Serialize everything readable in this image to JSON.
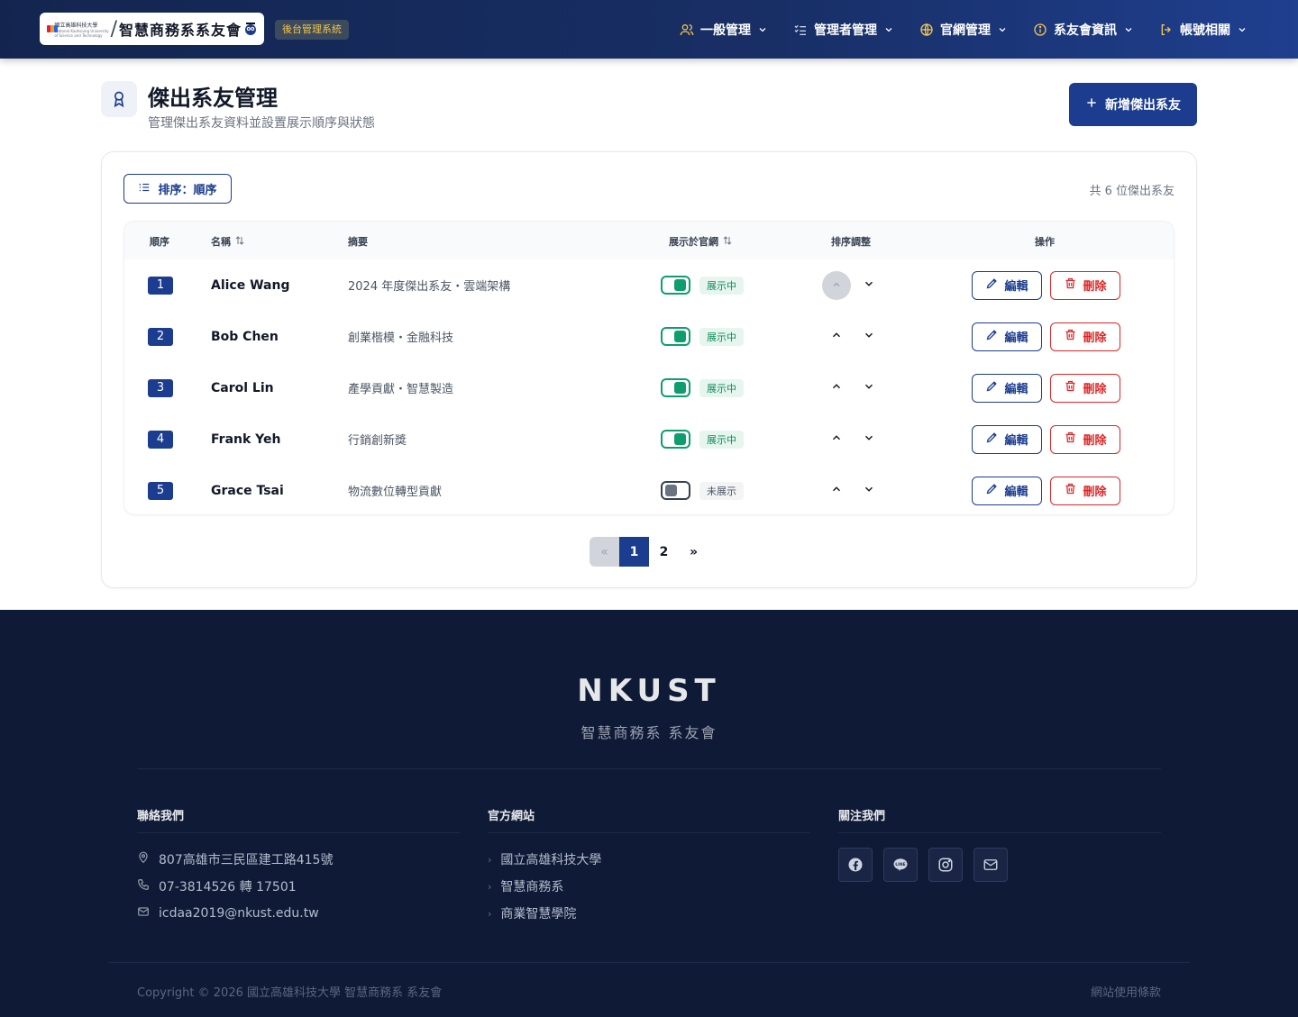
{
  "header": {
    "logo_school": "國立高雄科技大學",
    "logo_school_en1": "National Kaohsiung University",
    "logo_school_en2": "of Science and Technology",
    "logo_name": "智慧商務系系友會",
    "system_badge": "後台管理系統",
    "nav": [
      {
        "label": "一般管理",
        "icon": "users-icon"
      },
      {
        "label": "管理者管理",
        "icon": "checklist-icon"
      },
      {
        "label": "官網管理",
        "icon": "globe-icon"
      },
      {
        "label": "系友會資訊",
        "icon": "info-icon"
      },
      {
        "label": "帳號相關",
        "icon": "logout-icon"
      }
    ]
  },
  "page": {
    "title": "傑出系友管理",
    "subtitle": "管理傑出系友資料並設置展示順序與狀態",
    "add_button": "新增傑出系友",
    "sort_button": "排序：順序",
    "count_text": "共 6 位傑出系友"
  },
  "table": {
    "headers": [
      "順序",
      "名稱",
      "摘要",
      "展示於官網",
      "排序調整",
      "操作"
    ],
    "edit_label": "編輯",
    "delete_label": "刪除",
    "rows": [
      {
        "order": "1",
        "name": "Alice Wang",
        "summary": "2024 年度傑出系友・雲端架構",
        "status": "展示中",
        "visible": true
      },
      {
        "order": "2",
        "name": "Bob Chen",
        "summary": "創業楷模・金融科技",
        "status": "展示中",
        "visible": true
      },
      {
        "order": "3",
        "name": "Carol Lin",
        "summary": "產學貢獻・智慧製造",
        "status": "展示中",
        "visible": true
      },
      {
        "order": "4",
        "name": "Frank Yeh",
        "summary": "行銷創新獎",
        "status": "展示中",
        "visible": true
      },
      {
        "order": "5",
        "name": "Grace Tsai",
        "summary": "物流數位轉型貢獻",
        "status": "未展示",
        "visible": false
      }
    ]
  },
  "pagination": {
    "prev": "«",
    "pages": [
      "1",
      "2"
    ],
    "current": "1",
    "next": "»"
  },
  "footer": {
    "brand": "NKUST",
    "brand_sub": "智慧商務系 系友會",
    "contact_title": "聯絡我們",
    "contact": [
      {
        "icon": "map-pin-icon",
        "text": "807高雄市三民區建工路415號"
      },
      {
        "icon": "phone-icon",
        "text": "07-3814526 轉 17501"
      },
      {
        "icon": "mail-icon",
        "text": "icdaa2019@nkust.edu.tw"
      }
    ],
    "sites_title": "官方網站",
    "sites": [
      "國立高雄科技大學",
      "智慧商務系",
      "商業智慧學院"
    ],
    "follow_title": "關注我們",
    "socials": [
      "facebook-icon",
      "line-icon",
      "instagram-icon",
      "email-icon"
    ],
    "copyright": "Copyright © 2026 國立高雄科技大學 智慧商務系 系友會",
    "terms": "網站使用條款"
  },
  "colors": {
    "primary": "#1b3c8f",
    "danger": "#dc2626",
    "success": "#0f9d6e",
    "footer_bg": "#0f1a36"
  }
}
